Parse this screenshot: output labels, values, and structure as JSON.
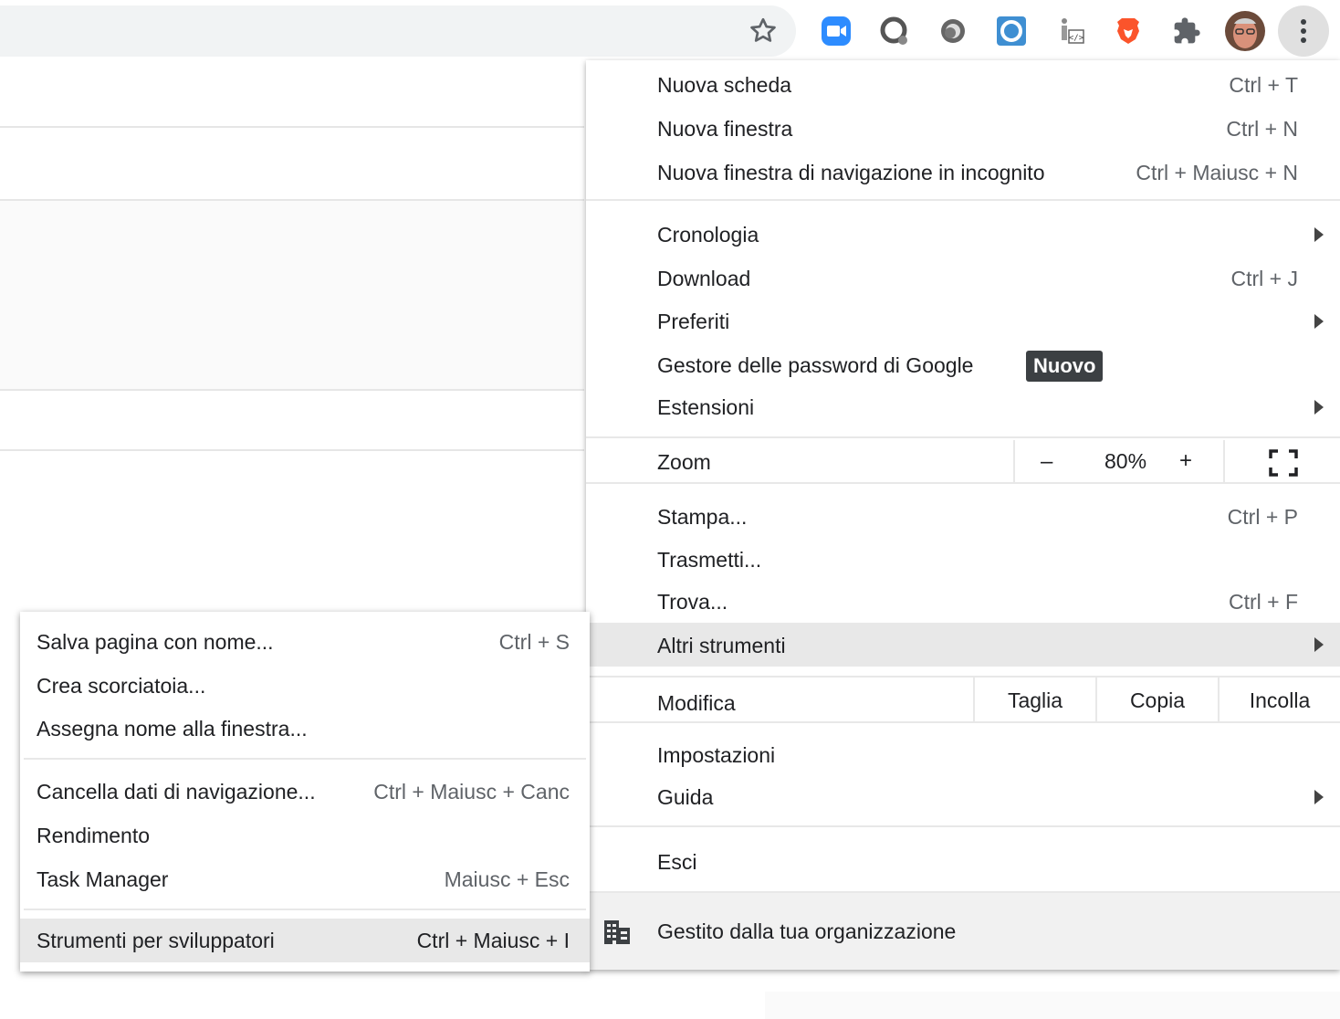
{
  "toolbar": {
    "bookmark_icon": "star-icon",
    "extensions": [
      "zoom-extension-icon",
      "search-extension-icon",
      "circle-extension-icon",
      "sync-extension-icon",
      "code-extension-icon",
      "brave-lion-icon",
      "puzzle-icon"
    ],
    "avatar": "profile-avatar",
    "menu_icon": "vertical-dots-icon"
  },
  "main_menu": {
    "new_tab": {
      "label": "Nuova scheda",
      "shortcut": "Ctrl + T"
    },
    "new_window": {
      "label": "Nuova finestra",
      "shortcut": "Ctrl + N"
    },
    "incognito": {
      "label": "Nuova finestra di navigazione in incognito",
      "shortcut": "Ctrl + Maiusc + N"
    },
    "history": {
      "label": "Cronologia"
    },
    "downloads": {
      "label": "Download",
      "shortcut": "Ctrl + J"
    },
    "bookmarks": {
      "label": "Preferiti"
    },
    "passwords": {
      "label": "Gestore delle password di Google",
      "badge": "Nuovo"
    },
    "extensions": {
      "label": "Estensioni"
    },
    "zoom": {
      "label": "Zoom",
      "minus": "–",
      "value": "80%",
      "plus": "+"
    },
    "print": {
      "label": "Stampa...",
      "shortcut": "Ctrl + P"
    },
    "cast": {
      "label": "Trasmetti..."
    },
    "find": {
      "label": "Trova...",
      "shortcut": "Ctrl + F"
    },
    "more_tools": {
      "label": "Altri strumenti"
    },
    "edit": {
      "label": "Modifica",
      "cut": "Taglia",
      "copy": "Copia",
      "paste": "Incolla"
    },
    "settings": {
      "label": "Impostazioni"
    },
    "help": {
      "label": "Guida"
    },
    "exit": {
      "label": "Esci"
    },
    "managed": {
      "label": "Gestito dalla tua organizzazione"
    }
  },
  "sub_menu": {
    "save_page": {
      "label": "Salva pagina con nome...",
      "shortcut": "Ctrl + S"
    },
    "create_shortcut": {
      "label": "Crea scorciatoia..."
    },
    "name_window": {
      "label": "Assegna nome alla finestra..."
    },
    "clear_data": {
      "label": "Cancella dati di navigazione...",
      "shortcut": "Ctrl + Maiusc + Canc"
    },
    "performance": {
      "label": "Rendimento"
    },
    "task_manager": {
      "label": "Task Manager",
      "shortcut": "Maiusc + Esc"
    },
    "dev_tools": {
      "label": "Strumenti per sviluppatori",
      "shortcut": "Ctrl + Maiusc + I"
    }
  },
  "colors": {
    "highlight": "#e8e8e8",
    "badge_bg": "#3c4043",
    "zoom_blue": "#2d8cff",
    "brave_orange": "#fb542b"
  }
}
